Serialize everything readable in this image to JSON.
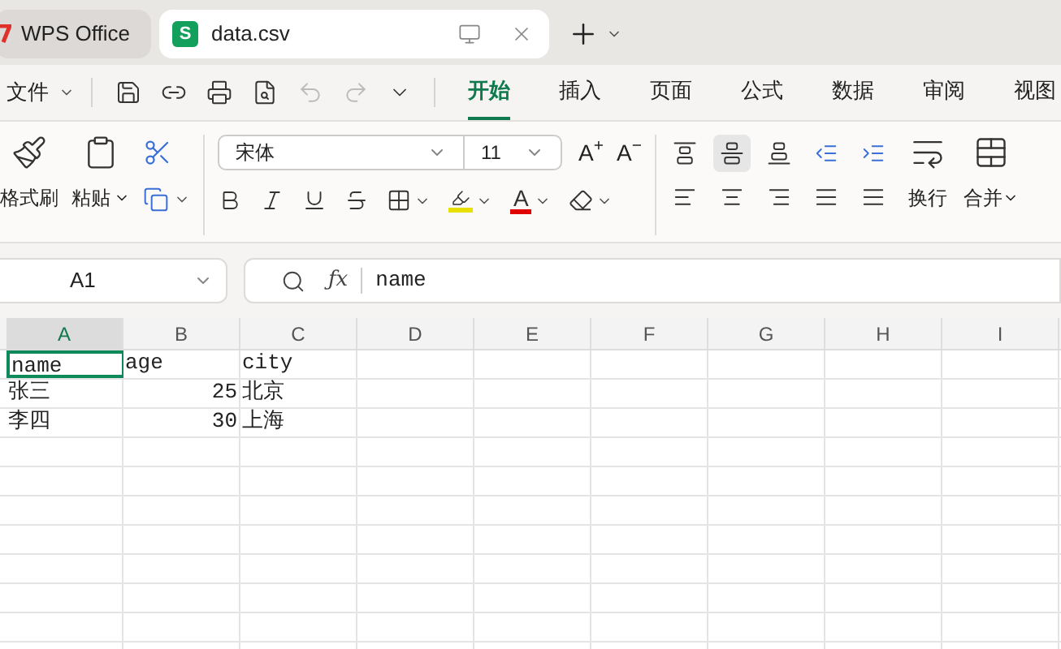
{
  "window_tabs": [
    {
      "label": "WPS Office",
      "selected": false,
      "kind": "home"
    },
    {
      "label": "data.csv",
      "selected": true,
      "kind": "sheet",
      "icon_letter": "S"
    }
  ],
  "menu": {
    "file": "文件",
    "tabs": [
      {
        "label": "开始",
        "selected": true
      },
      {
        "label": "插入",
        "selected": false
      },
      {
        "label": "页面",
        "selected": false
      },
      {
        "label": "公式",
        "selected": false
      },
      {
        "label": "数据",
        "selected": false
      },
      {
        "label": "审阅",
        "selected": false
      },
      {
        "label": "视图",
        "selected": false
      }
    ]
  },
  "ribbon": {
    "grow_font": "A$^{+}$",
    "shrink_font": "A$^{−}$",
    "font_color_glyph": "A",
    "format_painter": "格式刷",
    "paste": "粘贴",
    "font": "宋体",
    "font_size": "11",
    "wrap": "换行",
    "merge": "合并",
    "align_middle_selected": true
  },
  "formula_bar": {
    "cell": "A1",
    "fx": "ƒx",
    "value": "name"
  },
  "sheet": {
    "columns": [
      {
        "label": "A",
        "selected": true
      },
      {
        "label": "B",
        "selected": false
      },
      {
        "label": "C",
        "selected": false
      },
      {
        "label": "D",
        "selected": false
      },
      {
        "label": "E",
        "selected": false
      },
      {
        "label": "F",
        "selected": false
      },
      {
        "label": "G",
        "selected": false
      },
      {
        "label": "H",
        "selected": false
      },
      {
        "label": "I",
        "selected": false
      }
    ],
    "rows": [
      [
        {
          "text": "name",
          "selected": true
        },
        {
          "text": "age",
          "selected": false
        },
        {
          "text": "city",
          "selected": false
        }
      ],
      [
        {
          "text": "张三",
          "selected": false
        },
        {
          "text": "25",
          "selected": false,
          "kind": "number"
        },
        {
          "text": "北京",
          "selected": false
        }
      ],
      [
        {
          "text": "李四",
          "selected": false
        },
        {
          "text": "30",
          "selected": false,
          "kind": "number"
        },
        {
          "text": "上海",
          "selected": false
        }
      ]
    ]
  }
}
